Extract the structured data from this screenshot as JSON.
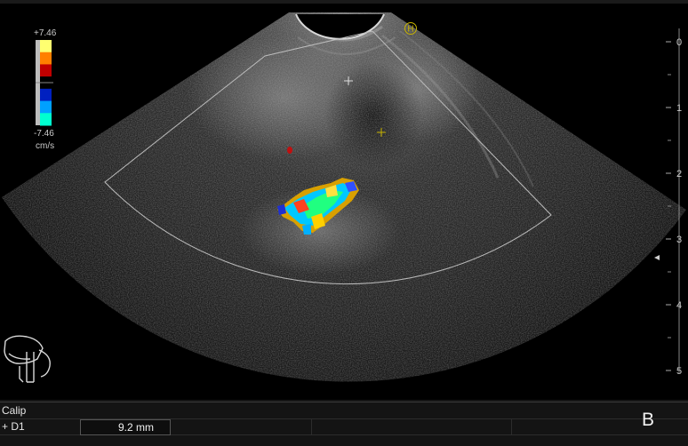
{
  "color_scale": {
    "max_label": "+7.46",
    "min_label": "-7.46",
    "unit": "cm/s",
    "colors": [
      "#ffff70",
      "#ff8000",
      "#c00000",
      "#000000",
      "#0020c0",
      "#00a0ff",
      "#00ffd0"
    ]
  },
  "orientation_marker": "H",
  "depth_scale": [
    "0",
    "1",
    "2",
    "3",
    "4",
    "5"
  ],
  "measurement_panel": {
    "title": "Calip",
    "rows": [
      {
        "marker": "+",
        "name": "D1",
        "value": "9.2 mm"
      }
    ]
  },
  "panel_letter": "B",
  "icons": [
    "crosshair-icon",
    "depth-pointer-icon",
    "anatomy-pictogram-icon"
  ]
}
